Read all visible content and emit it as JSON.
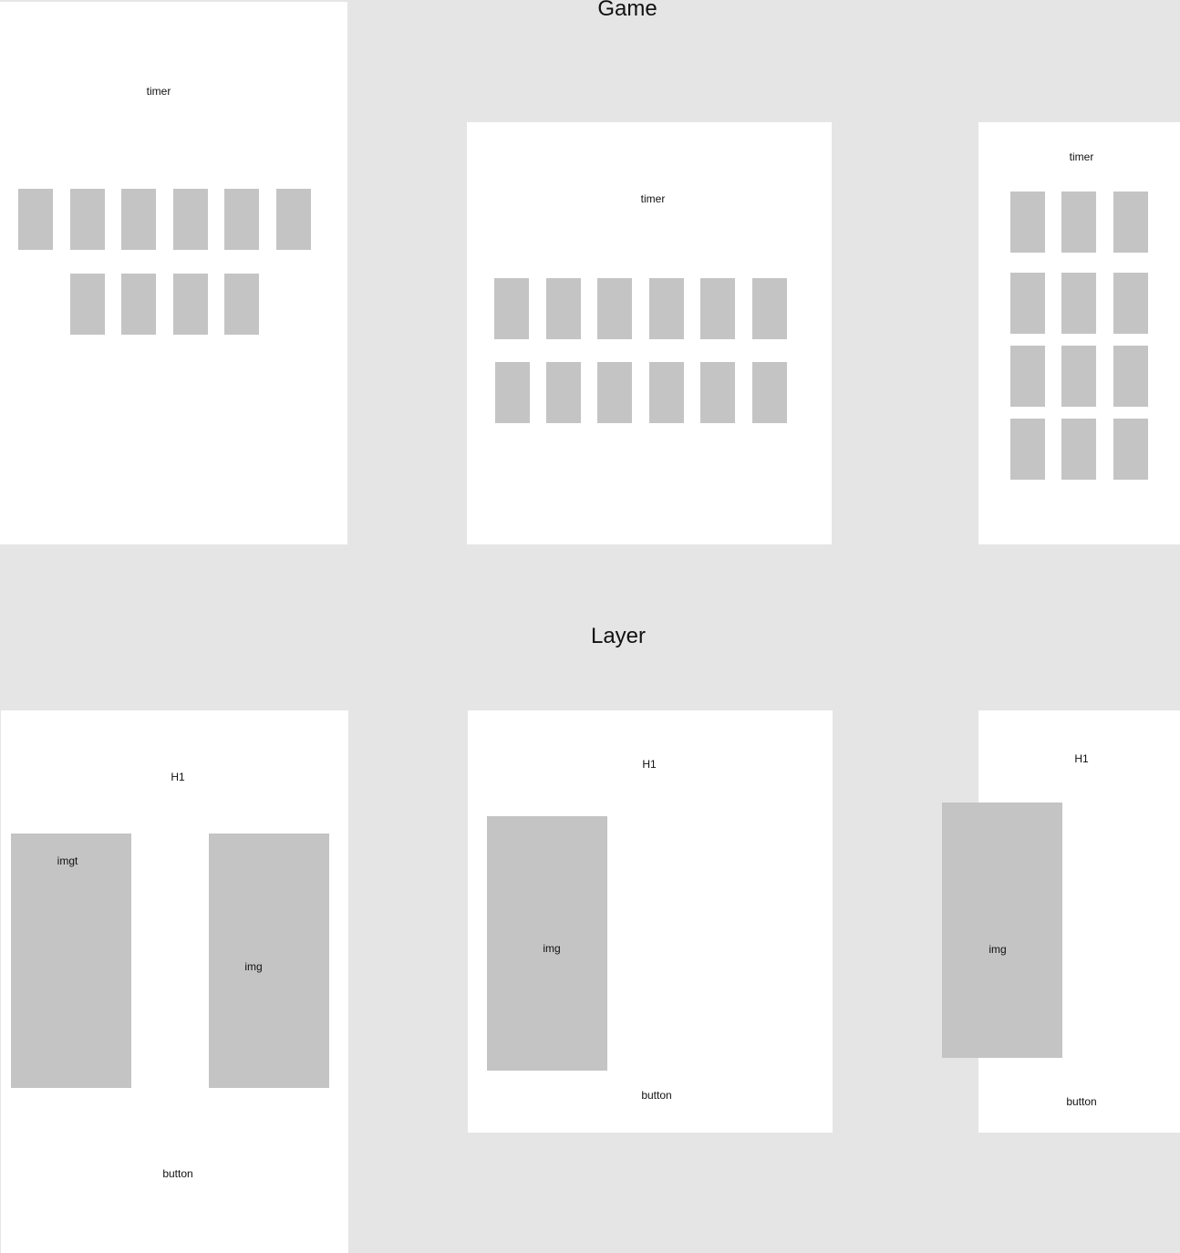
{
  "sections": {
    "game_title": "Game",
    "layer_title": "Layer"
  },
  "game": {
    "desktop": {
      "timer_label": "timer"
    },
    "tablet": {
      "timer_label": "timer"
    },
    "mobile": {
      "timer_label": "timer"
    }
  },
  "layer": {
    "desktop": {
      "heading": "H1",
      "img1_label": "imgt",
      "img2_label": "img",
      "button_label": "button"
    },
    "tablet": {
      "heading": "H1",
      "img_label": "img",
      "button_label": "button"
    },
    "mobile": {
      "heading": "H1",
      "img_label": "img",
      "button_label": "button"
    }
  },
  "colors": {
    "background": "#e5e5e5",
    "frame": "#ffffff",
    "placeholder": "#c4c4c4"
  }
}
